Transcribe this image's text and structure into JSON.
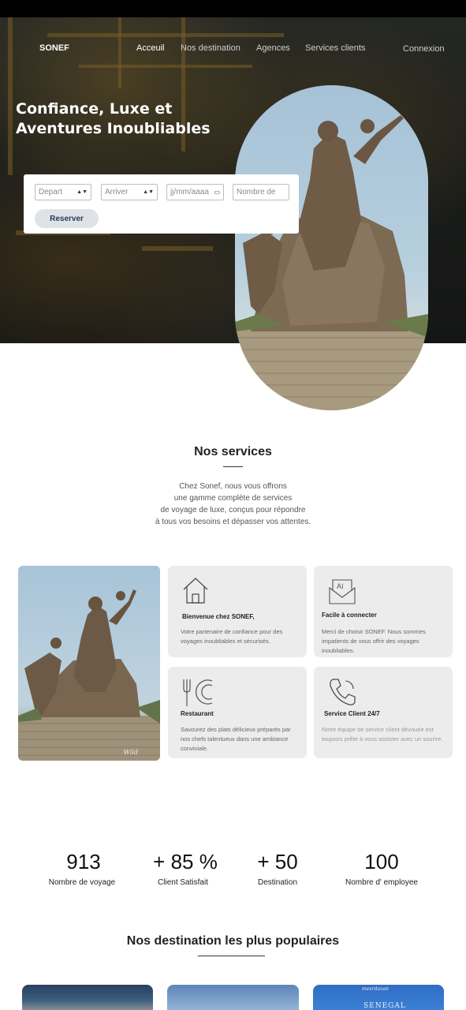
{
  "nav": {
    "logo": "SONEF",
    "links": [
      "Acceuil",
      "Nos destination",
      "Agences",
      "Services clients"
    ],
    "login": "Connexion"
  },
  "hero": {
    "title": "Confiance, Luxe et Aventures Inoubliables"
  },
  "booking": {
    "depart": "Depart",
    "arriver": "Arriver",
    "date": "jj/mm/aaaa",
    "passengers": "Nombre de",
    "reserve": "Reserver"
  },
  "services": {
    "title": "Nos services",
    "intro": [
      "Chez Sonef, nous vous offrons",
      "une gamme complète de services",
      "de voyage de luxe, conçus pour répondre",
      "à tous vos besoins et dépasser vos attentes."
    ],
    "photo_watermark": "Wild",
    "cards": [
      {
        "title": "Bienvenue chez SONEF,",
        "text": "Votre partenaire de confiance pour des voyages inoubliables et sécurisés.",
        "icon": "house-icon"
      },
      {
        "title": "Facile à connecter",
        "text": "Merci de choisir SONEF. Nous sommes impatients de vous offrir des voyages inoubliables.",
        "icon": "ai-mail-icon",
        "icon_text": "AI"
      },
      {
        "title": "Restaurant",
        "text": "Savourez des plats délicieux préparés par nos chefs talentueux dans une ambiance conviviale.",
        "icon": "restaurant-icon"
      },
      {
        "title": "Service Client 24/7",
        "text": "Notre équipe de service client dévouée est toujours prête à vous assister avec un sourire.",
        "icon": "phone-icon"
      }
    ]
  },
  "stats": [
    {
      "value": "913",
      "label": "Nombre de voyage"
    },
    {
      "value": "+ 85 %",
      "label": "Client Satisfait"
    },
    {
      "value": "+ 50",
      "label": "Destination"
    },
    {
      "value": "100",
      "label": "Nombre d' employee"
    }
  ],
  "destinations": {
    "title": "Nos destination les plus populaires",
    "cards": [
      {
        "caption": ""
      },
      {
        "caption": ""
      },
      {
        "caption": "meerdavan",
        "overlay": "SENEGAL"
      }
    ]
  },
  "colors": {
    "accent": "#2b3b55",
    "card_bg": "#ececec",
    "hero_overlay": "#1d201e"
  }
}
